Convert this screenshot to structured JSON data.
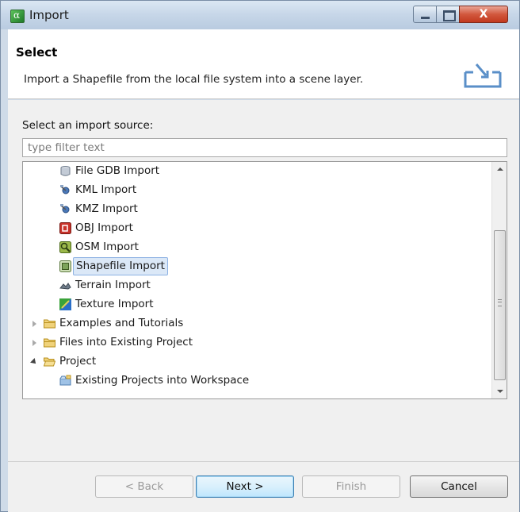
{
  "window": {
    "title": "Import",
    "close_glyph": "X"
  },
  "header": {
    "title": "Select",
    "description": "Import a Shapefile from the local file system into a scene layer."
  },
  "source": {
    "label": "Select an import source:",
    "filter_placeholder": "type filter text"
  },
  "tree": {
    "items": [
      {
        "label": "File GDB Import",
        "icon": "database-icon",
        "level": 1,
        "selected": false
      },
      {
        "label": "KML Import",
        "icon": "kml-icon",
        "level": 1,
        "selected": false
      },
      {
        "label": "KMZ Import",
        "icon": "kmz-icon",
        "level": 1,
        "selected": false
      },
      {
        "label": "OBJ Import",
        "icon": "obj-icon",
        "level": 1,
        "selected": false
      },
      {
        "label": "OSM Import",
        "icon": "osm-icon",
        "level": 1,
        "selected": false
      },
      {
        "label": "Shapefile Import",
        "icon": "shapefile-icon",
        "level": 1,
        "selected": true
      },
      {
        "label": "Terrain Import",
        "icon": "terrain-icon",
        "level": 1,
        "selected": false
      },
      {
        "label": "Texture Import",
        "icon": "texture-icon",
        "level": 1,
        "selected": false
      },
      {
        "label": "Examples and Tutorials",
        "icon": "folder-icon",
        "level": 0,
        "expanded": false
      },
      {
        "label": "Files into Existing Project",
        "icon": "folder-icon",
        "level": 0,
        "expanded": false
      },
      {
        "label": "Project",
        "icon": "folder-icon",
        "level": 0,
        "expanded": true
      },
      {
        "label": "Existing Projects into Workspace",
        "icon": "project-icon",
        "level": 1,
        "selected": false
      }
    ]
  },
  "buttons": {
    "back": "< Back",
    "next": "Next >",
    "finish": "Finish",
    "cancel": "Cancel"
  },
  "colors": {
    "selection_bg": "#dbe8f7",
    "selection_border": "#8db2e3",
    "folder": "#e8c45a"
  }
}
